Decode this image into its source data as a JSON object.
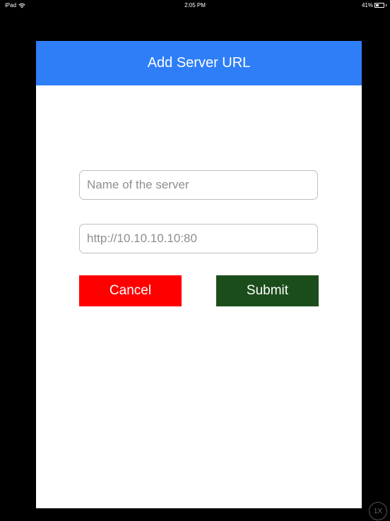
{
  "status_bar": {
    "device": "iPad",
    "time": "2:05 PM",
    "battery_text": "41%",
    "battery_level": 0.41
  },
  "dialog": {
    "title": "Add Server URL",
    "name_field": {
      "value": "",
      "placeholder": "Name of the server"
    },
    "url_field": {
      "value": "",
      "placeholder": "http://10.10.10.10:80"
    },
    "cancel_label": "Cancel",
    "submit_label": "Submit"
  },
  "zoom_badge": "1X",
  "colors": {
    "header": "#2e7ef7",
    "cancel": "#ff0000",
    "submit": "#1b4d1b"
  },
  "icons": [
    "wifi-icon",
    "battery-icon"
  ]
}
